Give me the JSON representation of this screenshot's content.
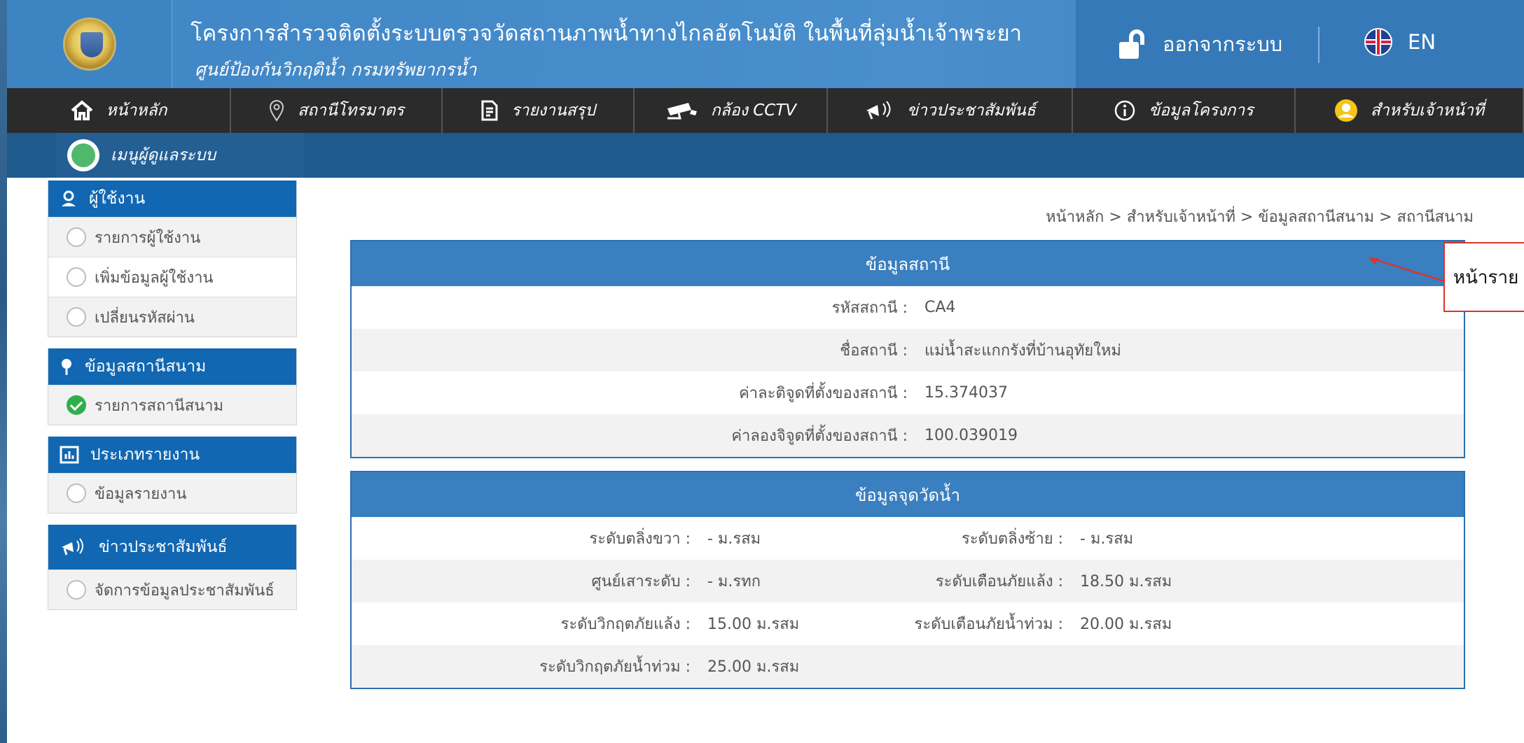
{
  "header": {
    "title": "โครงการสำรวจติดตั้งระบบตรวจวัดสถานภาพน้ำทางไกลอัตโนมัติ ในพื้นที่ลุ่มน้ำเจ้าพระยา",
    "subtitle": "ศูนย์ป้องกันวิกฤติน้ำ กรมทรัพยากรน้ำ",
    "logout_label": "ออกจากระบบ",
    "lang_label": "EN"
  },
  "nav": {
    "items": [
      {
        "label": "หน้าหลัก",
        "icon": "home-icon"
      },
      {
        "label": "สถานีโทรมาตร",
        "icon": "map-pin-icon"
      },
      {
        "label": "รายงานสรุป",
        "icon": "report-icon"
      },
      {
        "label": "กล้อง CCTV",
        "icon": "cctv-icon"
      },
      {
        "label": "ข่าวประชาสัมพันธ์",
        "icon": "megaphone-icon"
      },
      {
        "label": "ข้อมูลโครงการ",
        "icon": "info-icon"
      },
      {
        "label": "สำหรับเจ้าหน้าที่",
        "icon": "user-icon"
      }
    ]
  },
  "subbar": {
    "tab_label": "เมนูผู้ดูแลระบบ"
  },
  "sidebar": {
    "groups": [
      {
        "title": "ผู้ใช้งาน",
        "items": [
          "รายการผู้ใช้งาน",
          "เพิ่มข้อมูลผู้ใช้งาน",
          "เปลี่ยนรหัสผ่าน"
        ]
      },
      {
        "title": "ข้อมูลสถานีสนาม",
        "items": [
          "รายการสถานีสนาม"
        ]
      },
      {
        "title": "ประเภทรายงาน",
        "items": [
          "ข้อมูลรายงาน"
        ]
      },
      {
        "title": "ข่าวประชาสัมพันธ์",
        "items": [
          "จัดการข้อมูลประชาสัมพันธ์"
        ]
      }
    ]
  },
  "breadcrumb": "หน้าหลัก > สำหรับเจ้าหน้าที่ > ข้อมูลสถานีสนาม > สถานีสนาม",
  "station_panel": {
    "title": "ข้อมูลสถานี",
    "rows": [
      {
        "label": "รหัสสถานี :",
        "value": "CA4"
      },
      {
        "label": "ชื่อสถานี :",
        "value": "แม่น้ำสะแกกรังที่บ้านอุทัยใหม่"
      },
      {
        "label": "ค่าละติจูดที่ตั้งของสถานี :",
        "value": "15.374037"
      },
      {
        "label": "ค่าลองจิจูดที่ตั้งของสถานี :",
        "value": "100.039019"
      }
    ]
  },
  "water_panel": {
    "title": "ข้อมูลจุดวัดน้ำ",
    "rows": [
      {
        "l1": "ระดับตลิ่งขวา :",
        "v1": "- ม.รสม",
        "l2": "ระดับตลิ่งซ้าย :",
        "v2": "- ม.รสม"
      },
      {
        "l1": "ศูนย์เสาระดับ :",
        "v1": "- ม.รทก",
        "l2": "ระดับเตือนภัยแล้ง :",
        "v2": "18.50 ม.รสม"
      },
      {
        "l1": "ระดับวิกฤตภัยแล้ง :",
        "v1": "15.00 ม.รสม",
        "l2": "ระดับเตือนภัยน้ำท่วม :",
        "v2": "20.00 ม.รสม"
      },
      {
        "l1": "ระดับวิกฤตภัยน้ำท่วม :",
        "v1": "25.00 ม.รสม",
        "l2": "",
        "v2": ""
      }
    ]
  },
  "annotation": {
    "text": "หน้าราย"
  },
  "colors": {
    "header_blue": "#3f86c6",
    "nav_dark": "#2b2b2b",
    "subbar_blue": "#1e5a8e",
    "sidebar_head": "#1167b1",
    "panel_head": "#3a7fc0",
    "annotation_red": "#d9342b"
  }
}
